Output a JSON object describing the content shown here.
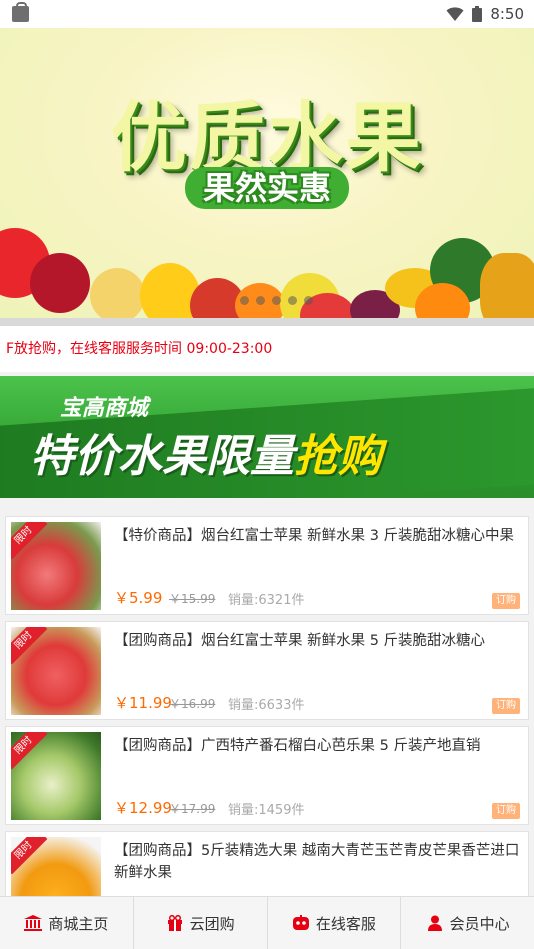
{
  "status": {
    "time": "8:50"
  },
  "banner": {
    "title": "优质水果",
    "subtitle": "果然实惠"
  },
  "notice": {
    "text": "F放抢购，在线客服服务时间 09:00-23:00"
  },
  "promo": {
    "small": "宝高商城",
    "big_prefix": "特价水果限量",
    "big_highlight": "抢购"
  },
  "products": [
    {
      "title": "【特价商品】烟台红富士苹果 新鲜水果 3 斤装脆甜冰糖心中果",
      "price": "￥5.99",
      "old_price": "￥15.99",
      "sales": "销量:6321件",
      "tag": "限时",
      "buy": "订购"
    },
    {
      "title": "【团购商品】烟台红富士苹果 新鲜水果 5 斤装脆甜冰糖心",
      "price": "￥11.99",
      "old_price": "￥16.99",
      "sales": "销量:6633件",
      "tag": "限时",
      "buy": "订购"
    },
    {
      "title": "【团购商品】广西特产番石榴白心芭乐果 5 斤装产地直销",
      "price": "￥12.99",
      "old_price": "￥17.99",
      "sales": "销量:1459件",
      "tag": "限时",
      "buy": "订购"
    },
    {
      "title": "【团购商品】5斤装精选大果 越南大青芒玉芒青皮芒果香芒进口新鲜水果",
      "price": "",
      "old_price": "",
      "sales": "",
      "tag": "限时",
      "buy": ""
    }
  ],
  "tabbar": [
    {
      "label": "商城主页",
      "icon": "bank-icon"
    },
    {
      "label": "云团购",
      "icon": "gift-icon"
    },
    {
      "label": "在线客服",
      "icon": "service-icon"
    },
    {
      "label": "会员中心",
      "icon": "user-icon"
    }
  ],
  "colors": {
    "accent": "#e60012",
    "price": "#ff6a00",
    "promo_green": "#2f9f2f"
  }
}
